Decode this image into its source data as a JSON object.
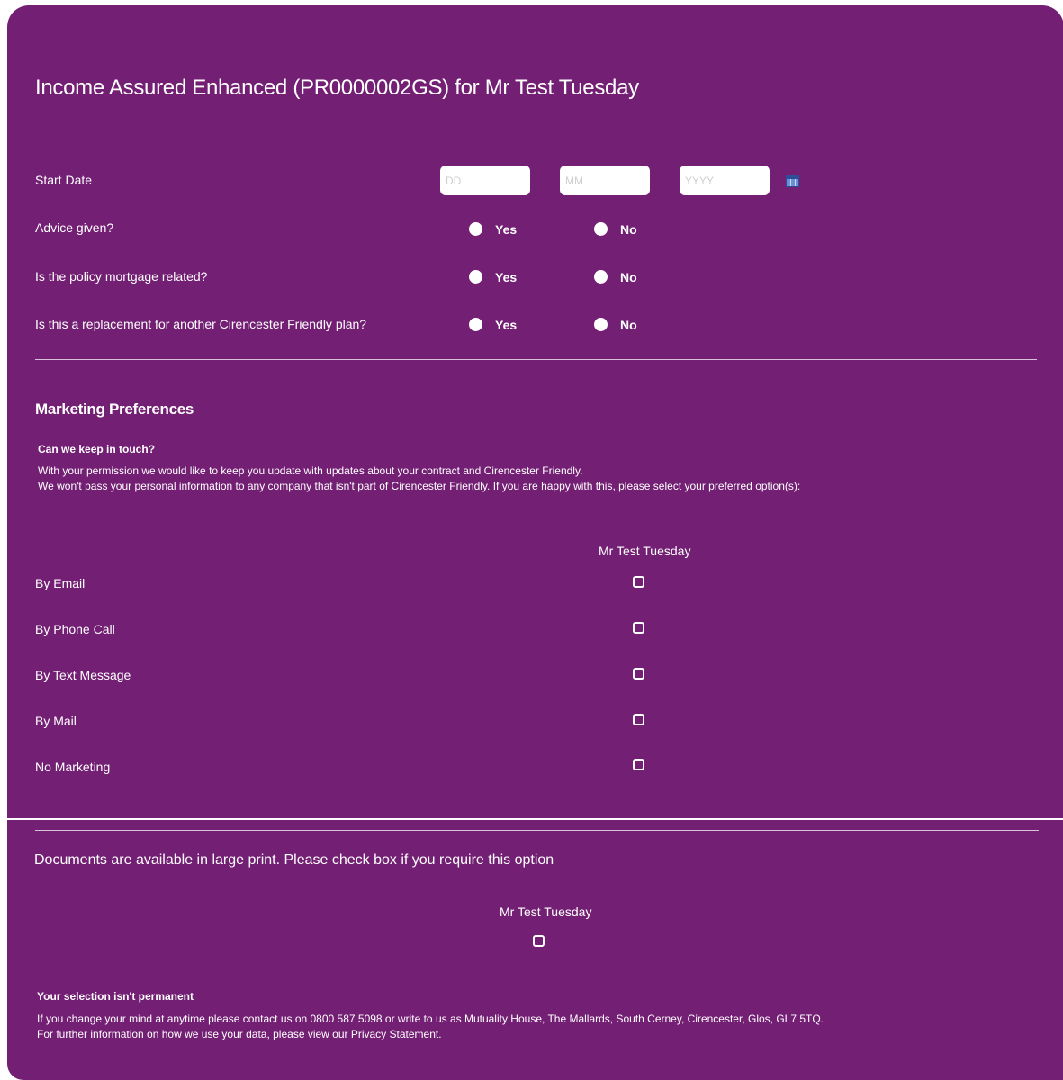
{
  "header": {
    "title": "Income Assured Enhanced (PR0000002GS) for Mr Test Tuesday"
  },
  "start_date": {
    "label": "Start Date",
    "dd_placeholder": "DD",
    "mm_placeholder": "MM",
    "yyyy_placeholder": "YYYY",
    "calendar_icon": "calendar-icon"
  },
  "questions": [
    {
      "label": "Advice given?",
      "yes": "Yes",
      "no": "No"
    },
    {
      "label": "Is the policy mortgage related?",
      "yes": "Yes",
      "no": "No"
    },
    {
      "label": "Is this a replacement for another Cirencester Friendly plan?",
      "yes": "Yes",
      "no": "No"
    }
  ],
  "marketing": {
    "heading": "Marketing Preferences",
    "subheading": "Can we keep in touch?",
    "intro_line1": "With your permission we would like to keep you update with updates about your contract and Cirencester Friendly.",
    "intro_line2": "We won't pass your personal information to any company that isn't part of Cirencester Friendly. If you are happy with this, please select your preferred option(s):",
    "column_header": "Mr Test Tuesday",
    "options": [
      "By Email",
      "By Phone Call",
      "By Text Message",
      "By Mail",
      "No Marketing"
    ]
  },
  "large_print": {
    "text": "Documents are available in large print. Please check box if you require this option",
    "column_header": "Mr Test Tuesday"
  },
  "footer": {
    "heading": "Your selection isn't permanent",
    "line1": "If you change your mind at anytime please contact us on 0800 587 5098 or write to us as Mutuality House, The Mallards, South Cerney, Cirencester, Glos, GL7 5TQ.",
    "line2": "For further information on how we use your data, please view our Privacy Statement."
  },
  "colors": {
    "panel_bg": "#731f73",
    "text": "#ffffff"
  }
}
